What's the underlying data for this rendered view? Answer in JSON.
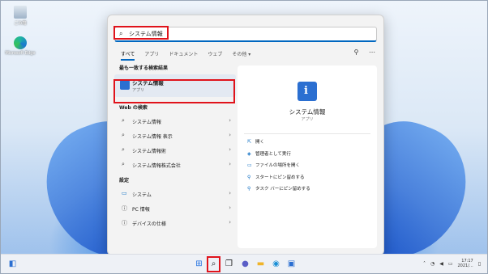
{
  "desktop": {
    "icons": [
      {
        "label": "ごみ箱",
        "icon": "recycle-bin-icon"
      },
      {
        "label": "Microsoft Edge",
        "icon": "edge-icon"
      }
    ]
  },
  "search": {
    "value": "システム情報",
    "icon": "search-icon"
  },
  "tabs": [
    "すべて",
    "アプリ",
    "ドキュメント",
    "ウェブ",
    "その他 ▾"
  ],
  "header_icons": [
    "share-icon",
    "more-icon"
  ],
  "best_match": {
    "heading": "最も一致する検索結果",
    "title": "システム情報",
    "subtitle": "アプリ"
  },
  "web": {
    "heading": "Web の検索",
    "items": [
      "システム情報",
      "システム情報 表示",
      "システム情報術",
      "システム情報株式会社"
    ]
  },
  "settings": {
    "heading": "設定",
    "items": [
      "システム",
      "PC 情報",
      "デバイスの仕様"
    ]
  },
  "detail": {
    "title": "システム情報",
    "subtitle": "アプリ",
    "actions": [
      "開く",
      "管理者として実行",
      "ファイルの場所を開く",
      "スタートにピン留めする",
      "タスク バーにピン留めする"
    ]
  },
  "taskbar": {
    "items": [
      "widgets-icon",
      "start-icon",
      "search-icon",
      "task-view-icon",
      "chat-icon",
      "explorer-icon",
      "edge-icon",
      "store-icon"
    ],
    "clock_time": "17:17",
    "clock_date": "2021/..."
  },
  "colors": {
    "accent": "#0067c0",
    "highlight": "#e0131b"
  }
}
